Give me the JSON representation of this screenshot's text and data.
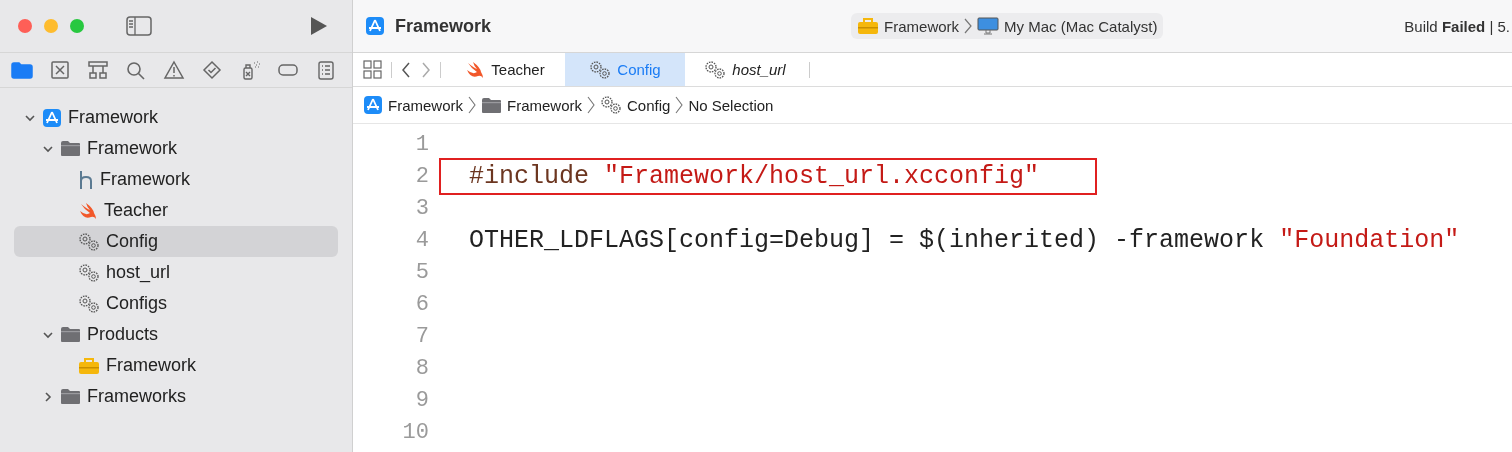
{
  "window": {
    "title": "Framework"
  },
  "toolbar": {
    "scheme": {
      "label": "Framework"
    },
    "destination": {
      "label": "My Mac (Mac Catalyst)"
    },
    "status": "Build **Failed** | 5."
  },
  "navigator_tabs": [
    {
      "kind": "files",
      "selected": true
    },
    {
      "kind": "source",
      "selected": false
    },
    {
      "kind": "symbols",
      "selected": false
    },
    {
      "kind": "search",
      "selected": false
    },
    {
      "kind": "issues",
      "selected": false
    },
    {
      "kind": "tests",
      "selected": false
    },
    {
      "kind": "debug",
      "selected": false
    },
    {
      "kind": "breakpoints",
      "selected": false
    },
    {
      "kind": "reports",
      "selected": false
    }
  ],
  "tree": [
    {
      "label": "Framework",
      "kind": "project",
      "selected": false,
      "expanded": true,
      "children": [
        {
          "label": "Framework",
          "kind": "folder",
          "selected": false,
          "expanded": true,
          "children": [
            {
              "label": "Framework",
              "kind": "header",
              "selected": false
            },
            {
              "label": "Teacher",
              "kind": "swift",
              "selected": false
            },
            {
              "label": "Config",
              "kind": "config",
              "selected": true
            },
            {
              "label": "host_url",
              "kind": "config",
              "selected": false
            },
            {
              "label": "Configs",
              "kind": "config",
              "selected": false
            }
          ]
        },
        {
          "label": "Products",
          "kind": "folder",
          "selected": false,
          "expanded": true,
          "children": [
            {
              "label": "Framework",
              "kind": "product",
              "selected": false
            }
          ]
        },
        {
          "label": "Frameworks",
          "kind": "folder",
          "selected": false,
          "expanded": false
        }
      ]
    }
  ],
  "editor_tabs": [
    {
      "label": "Teacher",
      "kind": "swift",
      "selected": false,
      "preview": false
    },
    {
      "label": "Config",
      "kind": "config",
      "selected": true,
      "preview": false
    },
    {
      "label": "host_url",
      "kind": "config",
      "selected": false,
      "preview": true
    }
  ],
  "breadcrumb": [
    {
      "label": "Framework",
      "kind": "project"
    },
    {
      "label": "Framework",
      "kind": "folder"
    },
    {
      "label": "Config",
      "kind": "config"
    },
    {
      "label": "No Selection",
      "kind": "none"
    }
  ],
  "code": [
    {
      "number": "1"
    },
    {
      "number": "2",
      "boxed": true,
      "tokens": [
        {
          "text": "#include ",
          "kind": "directive"
        },
        {
          "text": "\"Framework/host_url.xcconfig\"",
          "kind": "string"
        }
      ]
    },
    {
      "number": "3"
    },
    {
      "number": "4",
      "tokens": [
        {
          "text": "OTHER_LDFLAGS[config=Debug] = $(inherited) -framework ",
          "kind": "plain"
        },
        {
          "text": "\"Foundation\"",
          "kind": "string"
        }
      ]
    },
    {
      "number": "5"
    },
    {
      "number": "6"
    },
    {
      "number": "7"
    },
    {
      "number": "8"
    },
    {
      "number": "9"
    },
    {
      "number": "10"
    }
  ]
}
